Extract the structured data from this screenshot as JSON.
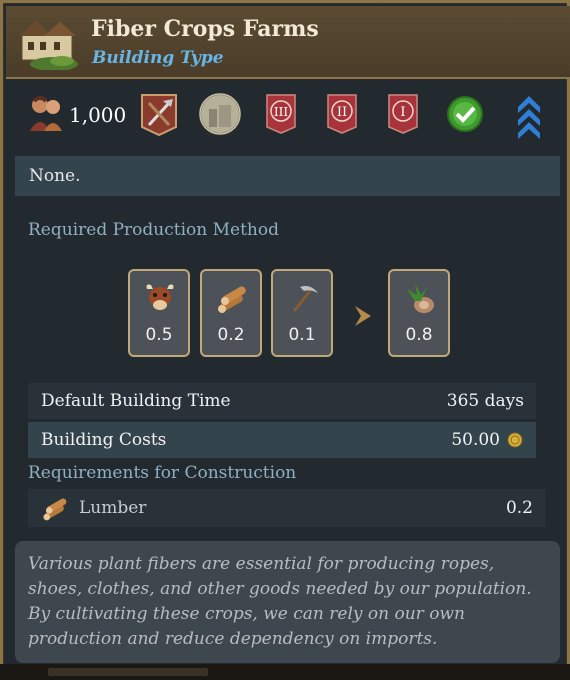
{
  "header": {
    "title": "Fiber Crops Farms",
    "subtitle": "Building Type"
  },
  "stats": {
    "population": "1,000",
    "icons": [
      "workers-icon",
      "tools-icon",
      "stone-building-icon",
      "tier-3-banner-icon",
      "tier-2-banner-icon",
      "tier-1-banner-icon",
      "checkmark-icon",
      "upgrade-chevrons-icon"
    ],
    "tier_labels": [
      "III",
      "II",
      "I"
    ]
  },
  "none_text": "None.",
  "production": {
    "label": "Required Production Method",
    "inputs": [
      {
        "icon": "cattle-icon",
        "value": "0.5"
      },
      {
        "icon": "lumber-icon",
        "value": "0.2"
      },
      {
        "icon": "pickaxe-icon",
        "value": "0.1"
      }
    ],
    "output": {
      "icon": "fiber-crop-icon",
      "value": "0.8"
    }
  },
  "building_time": {
    "label": "Default Building Time",
    "value": "365 days"
  },
  "building_costs": {
    "label": "Building Costs",
    "value": "50.00"
  },
  "requirements": {
    "label": "Requirements for Construction",
    "items": [
      {
        "icon": "lumber-icon",
        "label": "Lumber",
        "value": "0.2"
      }
    ]
  },
  "description": "Various plant fibers are essential for producing ropes, shoes, clothes, and other goods needed by our population. By cultivating these crops, we can rely on our own production and reduce dependency on imports.",
  "colors": {
    "header_bg": "#4f402b",
    "border_gold": "#8a7448",
    "title_text": "#f2e9d6",
    "subtitle_blue": "#67b6e8",
    "panel_bg": "#222a2f",
    "tier_banner_red": "#a8333b",
    "check_green": "#3f9a2e",
    "chevron_blue": "#2f7fd6"
  }
}
